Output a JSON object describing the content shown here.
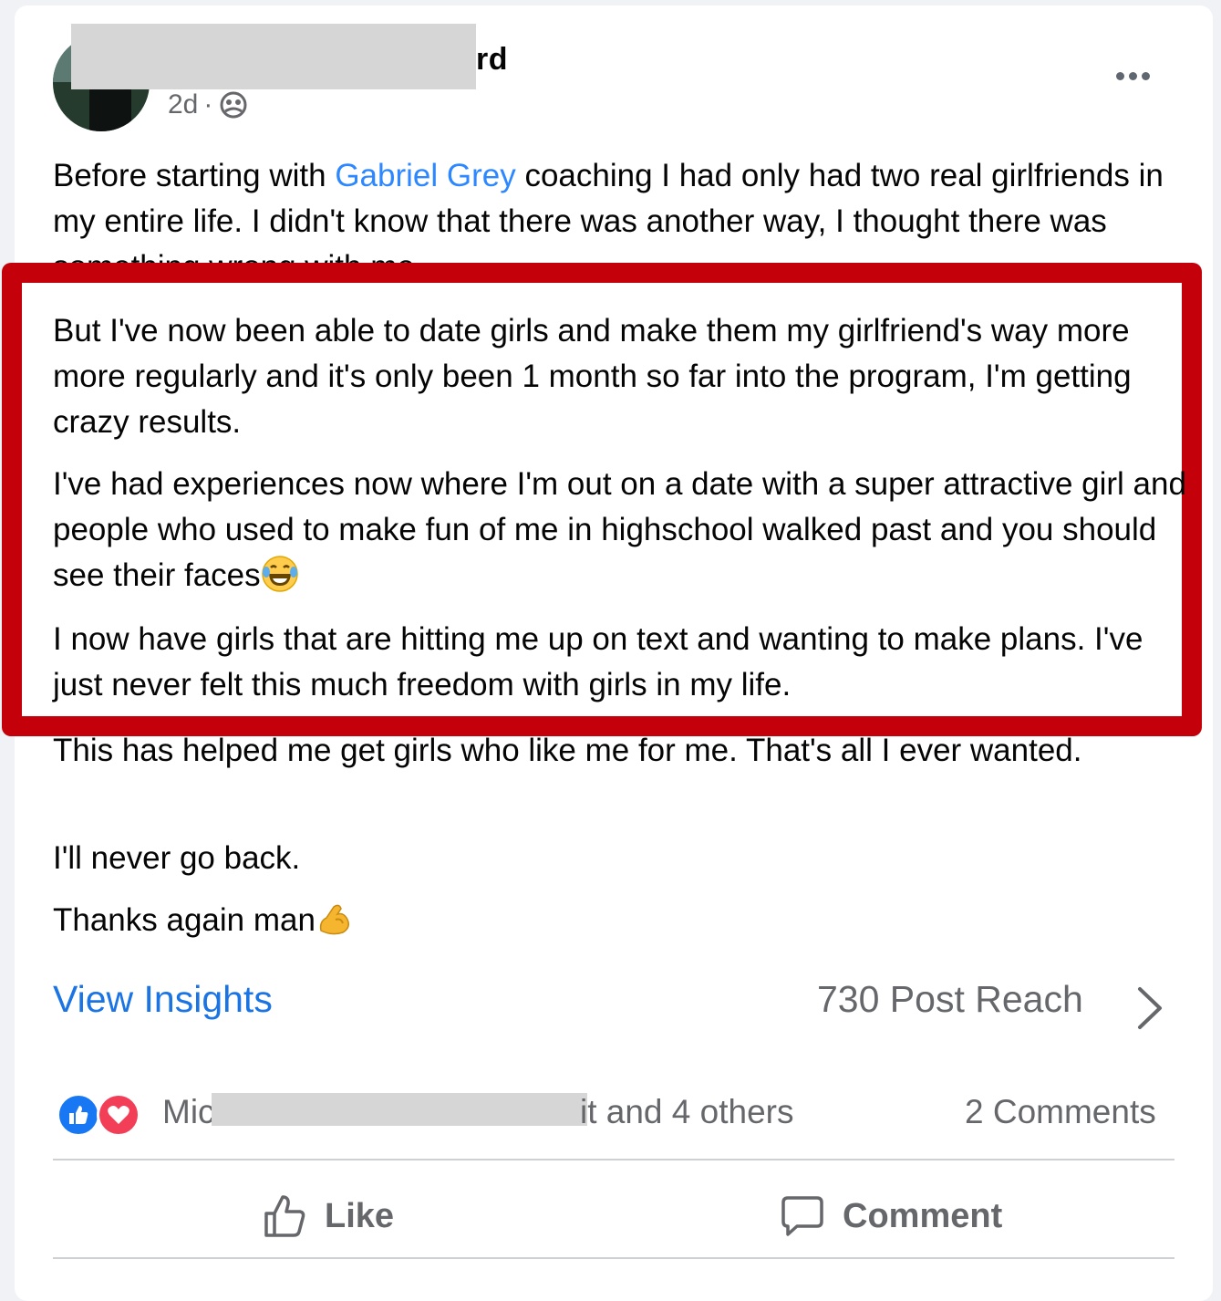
{
  "post": {
    "author_name_visible": "rd",
    "timestamp": "2d",
    "separator": "·",
    "audience_icon": "group-icon",
    "more_icon": "more-options-icon"
  },
  "body": {
    "p1_before": "Before starting with ",
    "p1_mention": "Gabriel Grey",
    "p1_after": " coaching I had only had two real girlfriends in my entire life. I didn't know that there was another way, I thought there was something wrong with me.",
    "p2": "But I've now been able to date girls and make them my girlfriend's way more more regularly and it's only been 1 month so far into the program, I'm getting crazy results.",
    "p3": "I've had experiences now where I'm out on a date with a super attractive girl and people who used to make fun of me in highschool walked past and you should see their faces",
    "p3_emoji": "laughing-tears-emoji",
    "p4": "I now have girls that are hitting me up on text and wanting to make plans. I've just never felt this much freedom with girls in my life.",
    "p5": "This has helped me get girls who like me for me. That's all I ever wanted.",
    "p6": "I'll never go back.",
    "p7": "Thanks again man",
    "p7_emoji": "flexed-bicep-emoji"
  },
  "insights": {
    "label": "View Insights",
    "reach": "730 Post Reach"
  },
  "reactions": {
    "names_start": "Mic",
    "names_end": "it and 4 others",
    "comments": "2 Comments",
    "icons": [
      "like-reaction-icon",
      "love-reaction-icon"
    ]
  },
  "actions": {
    "like": "Like",
    "comment": "Comment"
  },
  "colors": {
    "highlight_border": "#c4000a",
    "link": "#2d88ff",
    "insights": "#1b74e4",
    "like_reaction": "#1877f2",
    "love_reaction": "#f33e58"
  }
}
